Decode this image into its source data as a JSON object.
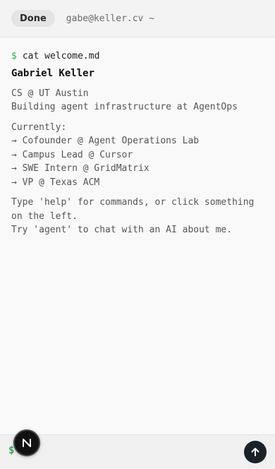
{
  "topbar": {
    "done_label": "Done",
    "host": "gabe@keller.cv ~"
  },
  "terminal": {
    "prompt": "$",
    "command": "cat welcome.md",
    "name": "Gabriel Keller",
    "line_school": "CS @ UT Austin",
    "line_building": "Building agent infrastructure at AgentOps",
    "currently_heading": "Currently:",
    "roles": [
      "→ Cofounder @ Agent Operations Lab",
      "→ Campus Lead @ Cursor",
      "→ SWE Intern @ GridMatrix",
      "→ VP @ Texas ACM"
    ],
    "help_line1": "Type 'help' for commands, or click something",
    "help_line2": "on the left.",
    "agent_line": "Try 'agent' to chat with an AI about me."
  },
  "input": {
    "prompt": "$",
    "value": ""
  },
  "icons": {
    "logo": "n-logo-icon",
    "send": "arrow-up-icon"
  },
  "colors": {
    "prompt_green": "#2fae4d",
    "send_button": "#1b2129"
  }
}
